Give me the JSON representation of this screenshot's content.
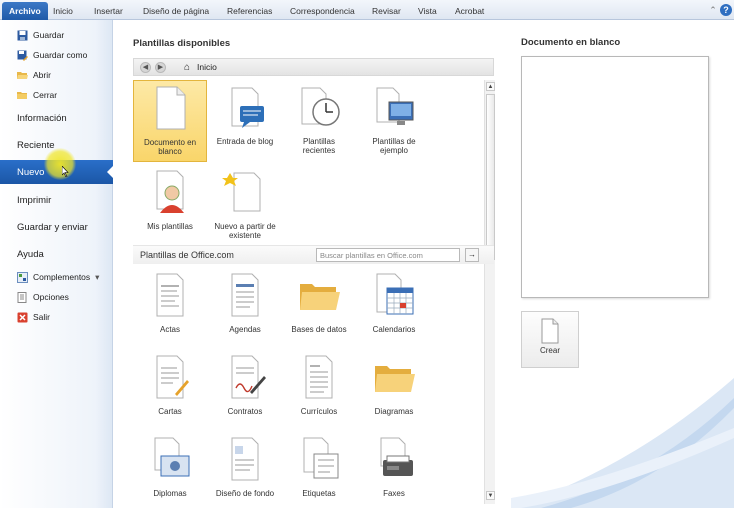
{
  "ribbon": {
    "tabs": [
      "Archivo",
      "Inicio",
      "Insertar",
      "Diseño de página",
      "Referencias",
      "Correspondencia",
      "Revisar",
      "Vista",
      "Acrobat"
    ],
    "help_icon": "help-icon",
    "minimize_icon": "chevron-up-icon"
  },
  "leftnav": {
    "items": [
      {
        "label": "Guardar",
        "icon": "save-icon"
      },
      {
        "label": "Guardar como",
        "icon": "save-as-icon"
      },
      {
        "label": "Abrir",
        "icon": "folder-open-icon"
      },
      {
        "label": "Cerrar",
        "icon": "folder-close-icon"
      },
      {
        "label": "Información"
      },
      {
        "label": "Reciente"
      },
      {
        "label": "Nuevo"
      },
      {
        "label": "Imprimir"
      },
      {
        "label": "Guardar y enviar"
      },
      {
        "label": "Ayuda"
      },
      {
        "label": "Complementos",
        "icon": "addins-icon",
        "suffix": "▾"
      },
      {
        "label": "Opciones",
        "icon": "options-icon"
      },
      {
        "label": "Salir",
        "icon": "exit-icon"
      }
    ]
  },
  "center": {
    "title": "Plantillas disponibles",
    "breadcrumb": "Inicio",
    "available": [
      {
        "label1": "Documento en",
        "label2": "blanco",
        "icon": "blank-document-icon",
        "selected": true
      },
      {
        "label1": "Entrada de blog",
        "label2": "",
        "icon": "blog-post-icon"
      },
      {
        "label1": "Plantillas",
        "label2": "recientes",
        "icon": "recent-templates-icon"
      },
      {
        "label1": "Plantillas de",
        "label2": "ejemplo",
        "icon": "sample-templates-icon"
      },
      {
        "label1": "Mis plantillas",
        "label2": "",
        "icon": "my-templates-icon"
      },
      {
        "label1": "Nuevo a partir de",
        "label2": "existente",
        "icon": "new-from-existing-icon"
      }
    ],
    "office_title": "Plantillas de Office.com",
    "office_search_placeholder": "Buscar plantillas en Office.com",
    "office": [
      {
        "label": "Actas",
        "icon": "minutes-doc-icon"
      },
      {
        "label": "Agendas",
        "icon": "agenda-doc-icon"
      },
      {
        "label": "Bases de datos",
        "icon": "folder-icon"
      },
      {
        "label": "Calendarios",
        "icon": "calendar-icon"
      },
      {
        "label": "Cartas",
        "icon": "letter-icon"
      },
      {
        "label": "Contratos",
        "icon": "contract-icon"
      },
      {
        "label": "Currículos",
        "icon": "resume-icon"
      },
      {
        "label": "Diagramas",
        "icon": "folder-icon"
      },
      {
        "label": "Diplomas",
        "icon": "diploma-icon"
      },
      {
        "label": "Diseño de fondo",
        "icon": "background-design-icon"
      },
      {
        "label": "Etiquetas",
        "icon": "labels-icon"
      },
      {
        "label": "Faxes",
        "icon": "fax-icon"
      }
    ]
  },
  "right": {
    "preview_title": "Documento en blanco",
    "create_label": "Crear"
  },
  "colors": {
    "accent": "#1f5aa8",
    "selection": "#f9d56a",
    "highlight": "#f0e628"
  }
}
